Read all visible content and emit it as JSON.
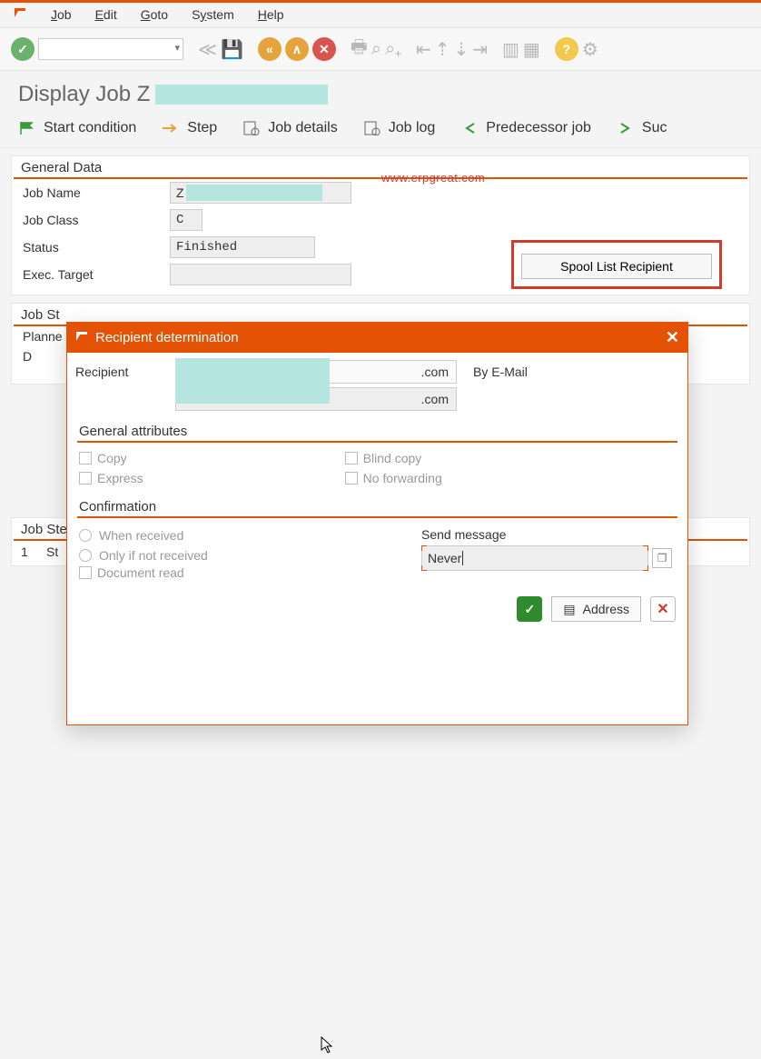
{
  "menu": {
    "items": [
      "Job",
      "Edit",
      "Goto",
      "System",
      "Help"
    ]
  },
  "page_title_prefix": "Display Job Z",
  "watermark": "www.erpgreat.com",
  "app_toolbar": {
    "start_condition": "Start condition",
    "step": "Step",
    "job_details": "Job details",
    "job_log": "Job log",
    "predecessor": "Predecessor job",
    "successor_partial": "Suc"
  },
  "general_data": {
    "header": "General Data",
    "job_name_label": "Job Name",
    "job_name_value_prefix": "Z",
    "job_class_label": "Job Class",
    "job_class_value": "C",
    "status_label": "Status",
    "status_value": "Finished",
    "exec_target_label": "Exec. Target",
    "exec_target_value": "",
    "spool_button": "Spool List Recipient"
  },
  "job_start": {
    "header": "Job St",
    "planned": "Planne",
    "d": "D"
  },
  "job_steps": {
    "header": "Job Ste",
    "row_num": "1",
    "row_text": "St"
  },
  "modal": {
    "title": "Recipient determination",
    "recipient_label": "Recipient",
    "recipient_suffix": ".com",
    "recipient_type": "By E-Mail",
    "recipient_suffix2": ".com",
    "general_attrs": "General attributes",
    "copy": "Copy",
    "blind_copy": "Blind copy",
    "express": "Express",
    "no_forward": "No forwarding",
    "confirmation": "Confirmation",
    "when_received": "When received",
    "only_if_not": "Only if not received",
    "doc_read": "Document read",
    "send_message": "Send message",
    "never": "Never",
    "address": "Address"
  }
}
